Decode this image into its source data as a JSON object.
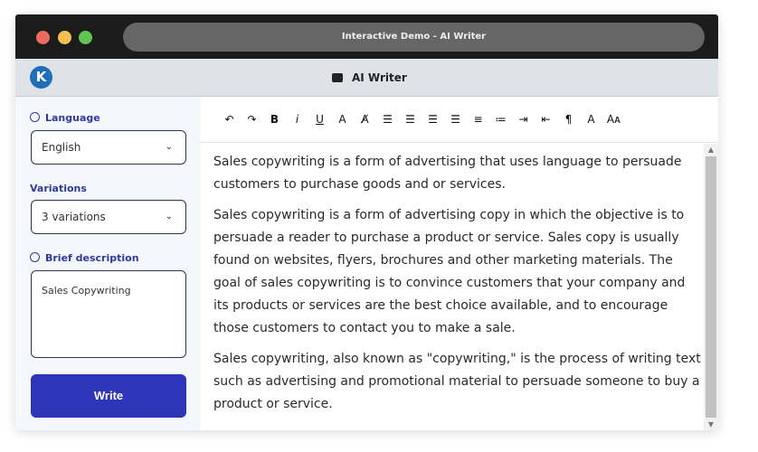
{
  "window": {
    "title": "Interactive Demo - AI Writer",
    "colors": {
      "close": "#ec6a5e",
      "min": "#f4bf4f",
      "max": "#61c554"
    }
  },
  "app": {
    "logo": "K",
    "title": "AI Writer"
  },
  "sidebar": {
    "language_label": "Language",
    "language_value": "English",
    "variations_label": "Variations",
    "variations_value": "3 variations",
    "brief_label": "Brief description",
    "brief_value": "Sales Copywriting",
    "write_button": "Write"
  },
  "toolbar": [
    {
      "name": "undo-icon",
      "glyph": "↶"
    },
    {
      "name": "redo-icon",
      "glyph": "↷"
    },
    {
      "name": "bold-icon",
      "glyph": "B"
    },
    {
      "name": "italic-icon",
      "glyph": "i"
    },
    {
      "name": "underline-icon",
      "glyph": "U"
    },
    {
      "name": "text-color-icon",
      "glyph": "A"
    },
    {
      "name": "clear-format-icon",
      "glyph": "A̸"
    },
    {
      "name": "align-left-icon",
      "glyph": "☰"
    },
    {
      "name": "align-center-icon",
      "glyph": "☰"
    },
    {
      "name": "align-right-icon",
      "glyph": "☰"
    },
    {
      "name": "justify-icon",
      "glyph": "☰"
    },
    {
      "name": "ordered-list-icon",
      "glyph": "≡"
    },
    {
      "name": "bullet-list-icon",
      "glyph": "≔"
    },
    {
      "name": "indent-icon",
      "glyph": "⇥"
    },
    {
      "name": "outdent-icon",
      "glyph": "⇤"
    },
    {
      "name": "paragraph-icon",
      "glyph": "¶"
    },
    {
      "name": "font-icon",
      "glyph": "A"
    },
    {
      "name": "font-size-icon",
      "glyph": "Aᴀ"
    }
  ],
  "content": [
    "Sales copywriting is a form of advertising that uses language to persuade customers to purchase goods and or services.",
    "Sales copywriting is a form of advertising copy in which the objective is to persuade a reader to purchase a product or service. Sales copy is usually found on websites, flyers, brochures and other marketing materials. The goal of sales copywriting is to convince customers that your company and its products or services are the best choice available, and to encourage those customers to contact you to make a sale.",
    "Sales copywriting, also known as \"copywriting,\" is the process of writing text such as advertising and promotional material to persuade someone to buy a product or service."
  ]
}
